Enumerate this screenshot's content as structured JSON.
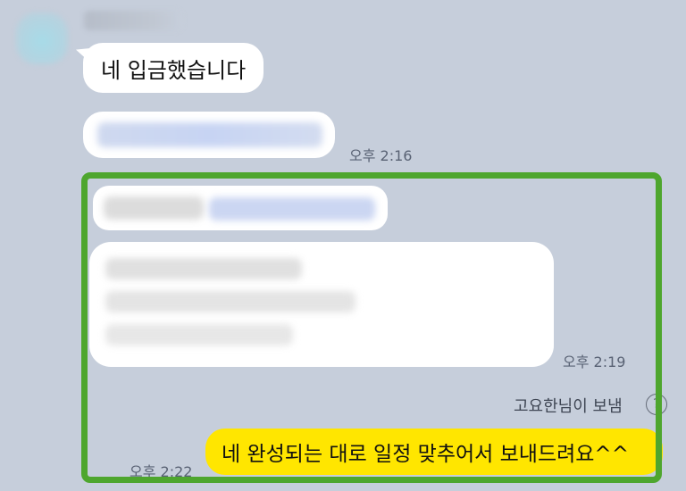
{
  "thread": {
    "received": {
      "message_text": "네 입금했습니다",
      "link_preview_time": "오후 2:16"
    },
    "sent_group": {
      "long_message_time": "오후 2:19",
      "status_text": "고요한님이 보냄",
      "help_icon": "?",
      "reply_text": "네 완성되는 대로 일정 맞추어서 보내드려요^^",
      "reply_time": "오후 2:22"
    }
  },
  "icons": {
    "help": "question-circle-icon"
  },
  "colors": {
    "chat_background": "#c6cedb",
    "highlight": "#4ea62e",
    "my_bubble": "#ffe600"
  }
}
